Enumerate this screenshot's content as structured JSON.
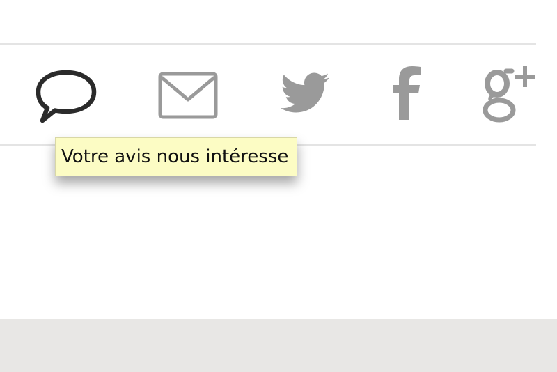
{
  "share_bar": {
    "icons": [
      {
        "name": "comment-icon"
      },
      {
        "name": "envelope-icon"
      },
      {
        "name": "twitter-bird-icon"
      },
      {
        "name": "facebook-f-icon"
      },
      {
        "name": "google-plus-icon"
      }
    ],
    "colors": {
      "comment_icon": "#2b2b2b",
      "share_icons": "#9a9a9a",
      "divider": "#e4e4e4"
    }
  },
  "tooltip": {
    "text": "Votre avis nous intéresse",
    "background": "#fcfcc4"
  },
  "footer": {
    "background": "#e8e7e5"
  }
}
